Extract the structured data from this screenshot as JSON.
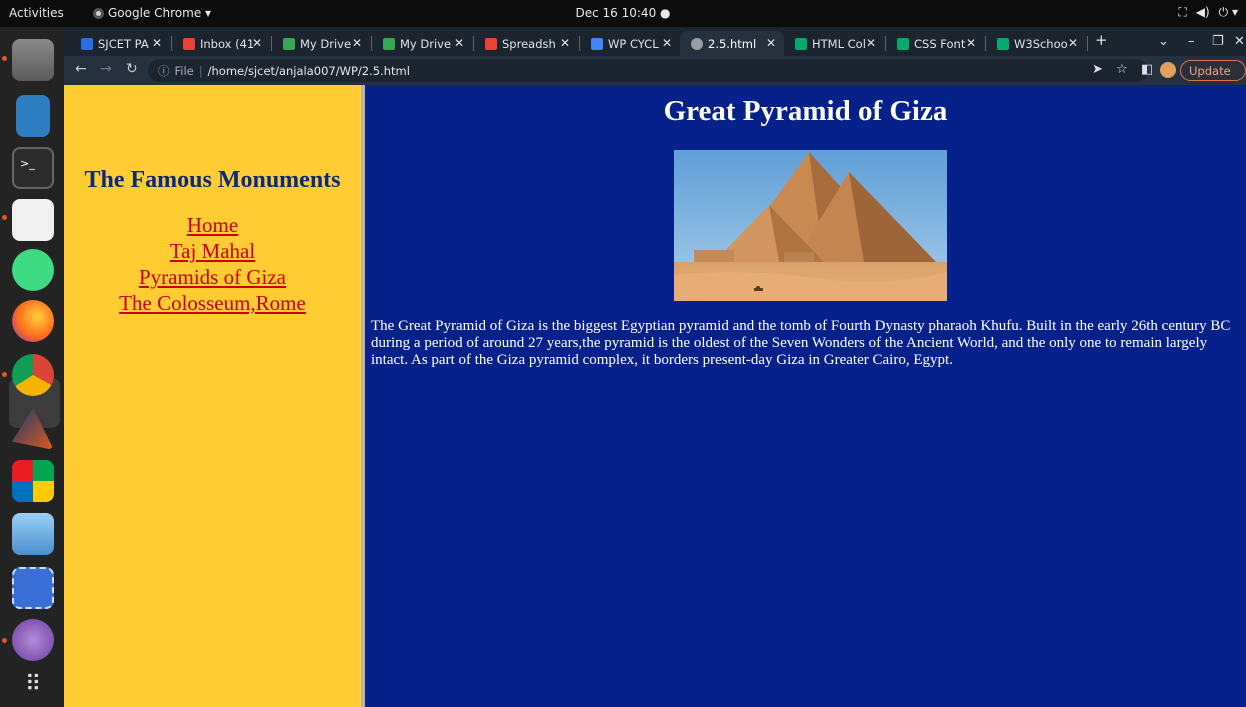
{
  "topbar": {
    "activities": "Activities",
    "app_menu": "Google Chrome ▾",
    "clock": "Dec 16  10:40  ●",
    "tray": [
      "⛶",
      "◀)",
      "⏻ ▾"
    ]
  },
  "tabs": [
    {
      "label": "SJCET PA",
      "favicon_color": "#2b6de0",
      "favicon_char": "S"
    },
    {
      "label": "Inbox (41",
      "favicon_color": "#ea4335",
      "favicon_char": "M"
    },
    {
      "label": "My Drive",
      "favicon_color": "#34a853",
      "favicon_char": "▲"
    },
    {
      "label": "My Drive",
      "favicon_color": "#34a853",
      "favicon_char": "▲"
    },
    {
      "label": "Spreadsh",
      "favicon_color": "#ea4335",
      "favicon_char": "M"
    },
    {
      "label": "WP CYCL",
      "favicon_color": "#4285f4",
      "favicon_char": "≡"
    },
    {
      "label": "2.5.html",
      "favicon_color": "#9aa0a6",
      "favicon_char": "◉"
    },
    {
      "label": "HTML Col",
      "favicon_color": "#04aa6d",
      "favicon_char": "w"
    },
    {
      "label": "CSS Font",
      "favicon_color": "#04aa6d",
      "favicon_char": "w"
    },
    {
      "label": "W3Schoo",
      "favicon_color": "#04aa6d",
      "favicon_char": "w"
    }
  ],
  "toolbar": {
    "url_prefix": "File",
    "url": "/home/sjcet/anjala007/WP/2.5.html",
    "update_label": "Update"
  },
  "sidebar": {
    "heading": "The Famous Monuments",
    "links": [
      "Home",
      "Taj Mahal",
      "Pyramids of Giza",
      "The Colosseum,Rome"
    ]
  },
  "main": {
    "title": "Great Pyramid of Giza",
    "paragraph": "The Great Pyramid of Giza is the biggest Egyptian pyramid and the tomb of Fourth Dynasty pharaoh Khufu. Built in the early 26th century BC during a period of around 27 years,the pyramid is the oldest of the Seven Wonders of the Ancient World, and the only one to remain largely intact. As part of the Giza pyramid complex, it borders present-day Giza in Greater Cairo, Egypt."
  },
  "colors": {
    "sidebar_bg": "#ffcc33",
    "main_bg": "#06218a",
    "link": "#cc0000",
    "heading": "#0c2a7a"
  }
}
